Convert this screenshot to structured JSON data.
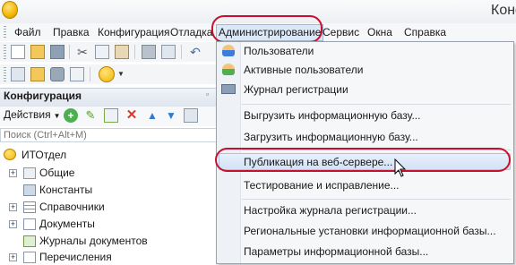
{
  "window": {
    "title": "Конф"
  },
  "menubar": {
    "items": [
      "Файл",
      "Правка",
      "Конфигурация",
      "Отладка",
      "Администрирование",
      "Сервис",
      "Окна",
      "Справка"
    ]
  },
  "config_panel": {
    "title": "Конфигурация",
    "actions_label": "Действия",
    "search_placeholder": "Поиск (Ctrl+Alt+M)",
    "tree": {
      "root": "ИТОтдел",
      "items": [
        "Общие",
        "Константы",
        "Справочники",
        "Документы",
        "Журналы документов",
        "Перечисления"
      ]
    }
  },
  "admin_menu": {
    "items": [
      "Пользователи",
      "Активные пользователи",
      "Журнал регистрации",
      "Выгрузить информационную базу...",
      "Загрузить информационную базу...",
      "Публикация на веб-сервере...",
      "Тестирование и исправление...",
      "Настройка журнала регистрации...",
      "Региональные установки информационной базы...",
      "Параметры информационной базы..."
    ]
  },
  "colors": {
    "annotation": "#c8102e",
    "highlight": "#d3e2f5",
    "accent": "#3c7dd9"
  }
}
